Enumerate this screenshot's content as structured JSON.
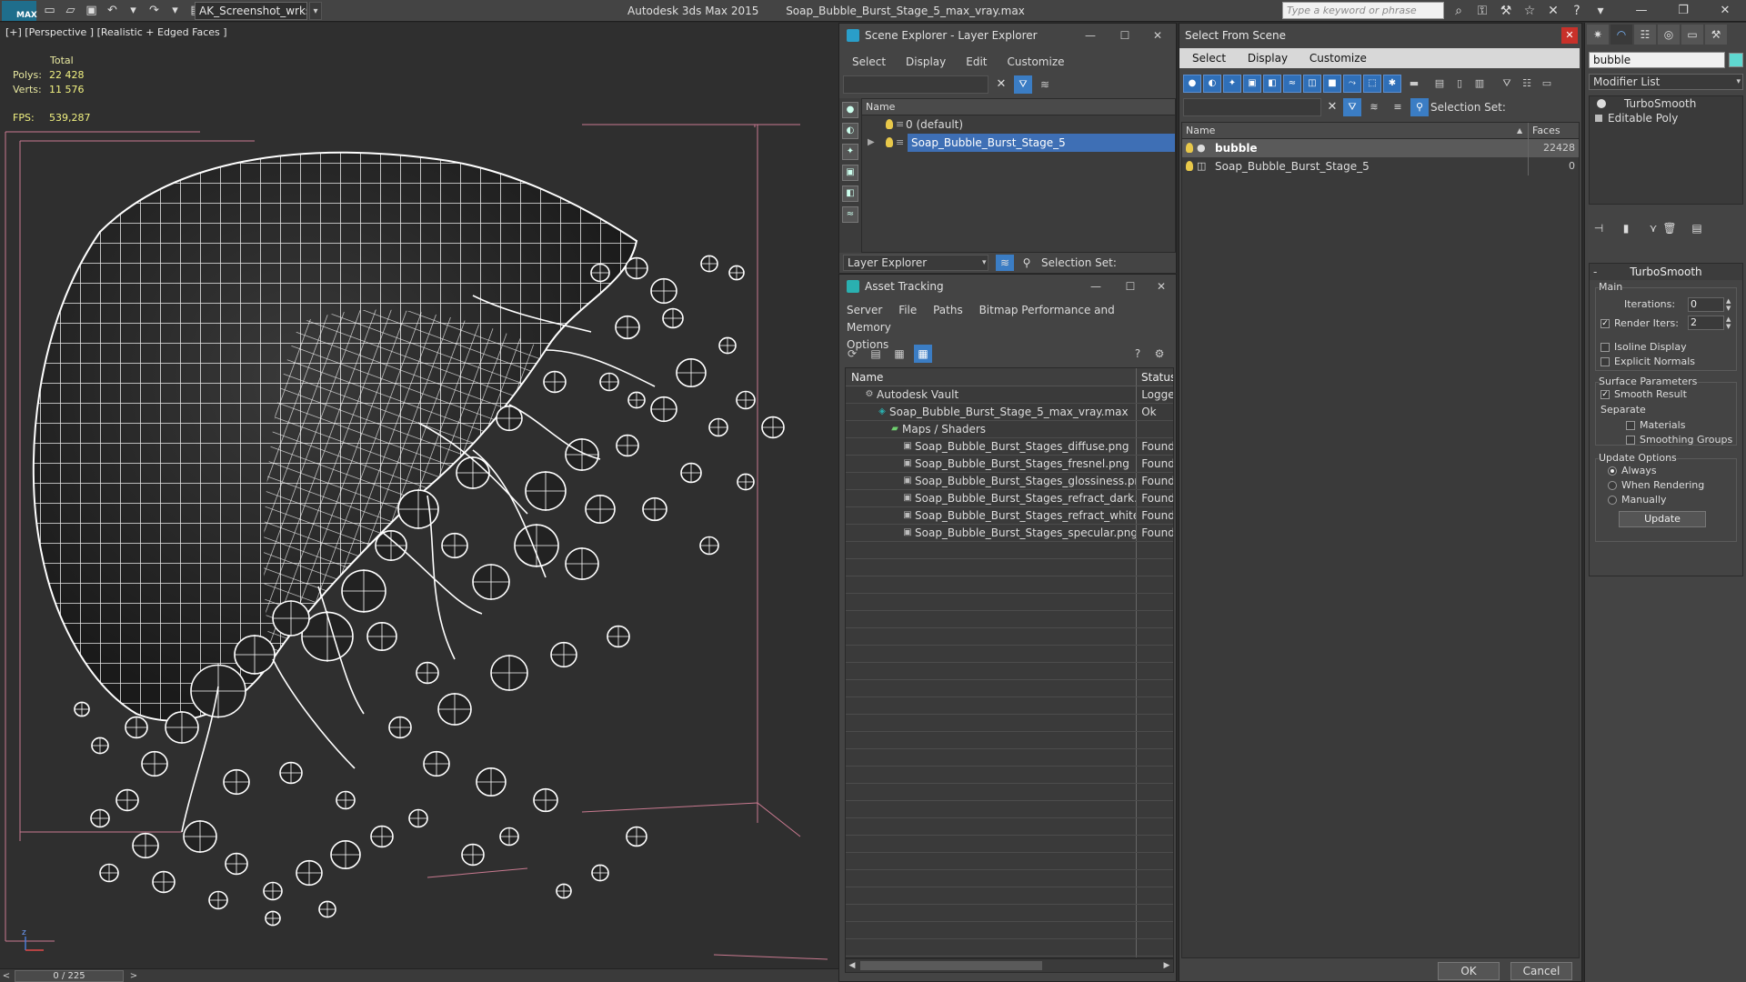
{
  "titlebar": {
    "logo": "MAX",
    "workspace": "AK_Screenshot_wrksp",
    "app_name": "Autodesk 3ds Max  2015",
    "file_name": "Soap_Bubble_Burst_Stage_5_max_vray.max",
    "search_placeholder": "Type a keyword or phrase"
  },
  "viewport": {
    "label": "[+] [Perspective ] [Realistic + Edged Faces ]",
    "stats_header": "Total",
    "polys_label": "Polys:",
    "polys_value": "22 428",
    "verts_label": "Verts:",
    "verts_value": "11 576",
    "fps_label": "FPS:",
    "fps_value": "539,287"
  },
  "timeline": {
    "frame": "0 / 225"
  },
  "scene_explorer": {
    "title": "Scene Explorer - Layer Explorer",
    "menu": [
      "Select",
      "Display",
      "Edit",
      "Customize"
    ],
    "column_name": "Name",
    "layers": [
      {
        "name": "0 (default)",
        "selected": false
      },
      {
        "name": "Soap_Bubble_Burst_Stage_5",
        "selected": true
      }
    ],
    "footer_dropdown": "Layer Explorer",
    "selection_set": "Selection Set:"
  },
  "asset_tracking": {
    "title": "Asset Tracking",
    "menu": [
      "Server",
      "File",
      "Paths",
      "Bitmap Performance and Memory",
      "Options"
    ],
    "col_name": "Name",
    "col_status": "Status",
    "rows": [
      {
        "name": "Autodesk Vault",
        "status": "Logged",
        "indent": 0,
        "icon": "vault"
      },
      {
        "name": "Soap_Bubble_Burst_Stage_5_max_vray.max",
        "status": "Ok",
        "indent": 1,
        "icon": "max"
      },
      {
        "name": "Maps / Shaders",
        "status": "",
        "indent": 2,
        "icon": "folder"
      },
      {
        "name": "Soap_Bubble_Burst_Stages_diffuse.png",
        "status": "Found",
        "indent": 3,
        "icon": "file"
      },
      {
        "name": "Soap_Bubble_Burst_Stages_fresnel.png",
        "status": "Found",
        "indent": 3,
        "icon": "file"
      },
      {
        "name": "Soap_Bubble_Burst_Stages_glossiness.png",
        "status": "Found",
        "indent": 3,
        "icon": "file"
      },
      {
        "name": "Soap_Bubble_Burst_Stages_refract_dark.png",
        "status": "Found",
        "indent": 3,
        "icon": "file"
      },
      {
        "name": "Soap_Bubble_Burst_Stages_refract_white.p...",
        "status": "Found",
        "indent": 3,
        "icon": "file"
      },
      {
        "name": "Soap_Bubble_Burst_Stages_specular.png",
        "status": "Found",
        "indent": 3,
        "icon": "file"
      }
    ]
  },
  "select_scene": {
    "title": "Select From Scene",
    "menu": [
      "Select",
      "Display",
      "Customize"
    ],
    "selection_set": "Selection Set:",
    "col_name": "Name",
    "col_faces": "Faces",
    "rows": [
      {
        "name": "bubble",
        "faces": "22428",
        "selected": true
      },
      {
        "name": "Soap_Bubble_Burst_Stage_5",
        "faces": "0",
        "selected": false
      }
    ],
    "ok": "OK",
    "cancel": "Cancel"
  },
  "command_panel": {
    "object_name": "bubble",
    "object_color": "#5fd8d0",
    "modifier_list": "Modifier List",
    "stack": [
      "TurboSmooth",
      "Editable Poly"
    ],
    "rollout_title": "TurboSmooth",
    "main_group": "Main",
    "iterations_label": "Iterations:",
    "iterations_value": "0",
    "render_iters_label": "Render Iters:",
    "render_iters_value": "2",
    "render_iters_checked": true,
    "isoline_label": "Isoline Display",
    "explicit_normals_label": "Explicit Normals",
    "surface_group": "Surface Parameters",
    "smooth_result_label": "Smooth Result",
    "separate_label": "Separate",
    "materials_label": "Materials",
    "smoothing_groups_label": "Smoothing Groups",
    "update_group": "Update Options",
    "always_label": "Always",
    "when_rendering_label": "When Rendering",
    "manually_label": "Manually",
    "update_button": "Update"
  },
  "colors": {
    "accent": "#3e6fb5",
    "stats": "#f0f080",
    "close": "#c8312a"
  }
}
